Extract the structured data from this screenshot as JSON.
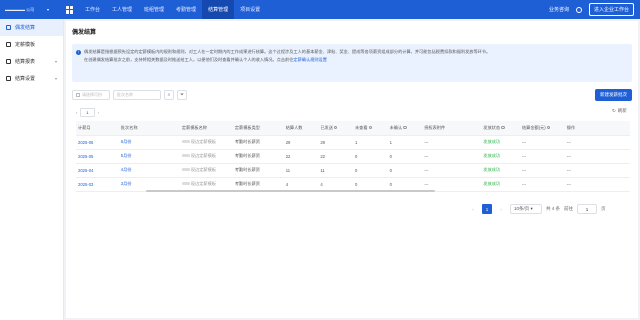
{
  "topbar": {
    "brand": "▬▬▬▬▬ 公司",
    "nav": [
      "工作台",
      "工人管理",
      "班组管理",
      "考勤管理",
      "结算管理",
      "项目设置"
    ],
    "active_nav": 4,
    "service": "业务咨询",
    "enter_button": "进入企业工作台"
  },
  "sidebar": {
    "items": [
      {
        "label": "偶发结算",
        "active": true
      },
      {
        "label": "定薪模板",
        "active": false
      },
      {
        "label": "结算报表",
        "active": false
      },
      {
        "label": "结算设置",
        "active": false
      }
    ]
  },
  "page": {
    "title": "偶发结算",
    "notice_line1": "偶发结算是指根据预先设定的定薪模板内的规则和规则，对工人在一定时期内的工作成果进行核算。这个过程涉及工人的基本薪金、津贴、奖金、提成等各项薪资组成部分的计算，并可能包括税费扣款和福利发放等环节。",
    "notice_line2_prefix": "在创建偶发结算批次之前，支持将相关数据及时推送给工人，以便他们及时查看并确认个人的收入情况。点击前往",
    "notice_link": "定薪确认规则设置"
  },
  "filters": {
    "month_placeholder": "请选择月份",
    "batch_placeholder": "批次名称",
    "search_icon": "search-icon",
    "filter_icon": "funnel-icon",
    "new_batch_button": "新建发薪批次"
  },
  "mini_pager": {
    "prev": "‹",
    "num": "1",
    "next": "›"
  },
  "refresh_label": "刷新",
  "table": {
    "headers": [
      "计薪月",
      "批次名称",
      "定薪模板名称",
      "定薪模板类型",
      "结算人数",
      "已发送",
      "未查看",
      "未确认",
      "授权表附件",
      "发放状态",
      "结算金额(元)",
      "操作"
    ],
    "rows": [
      {
        "month": "2025-06",
        "batch": "6月份",
        "template": "现边定薪模板",
        "type": "考勤时长薪资",
        "count": "29",
        "sent": "29",
        "unviewed": "1",
        "unconfirmed": "1",
        "attachment": "---",
        "status": "发放成功",
        "amount": "---",
        "op": "---"
      },
      {
        "month": "2025-05",
        "batch": "5月份",
        "template": "现边定薪模板",
        "type": "考勤时长薪资",
        "count": "22",
        "sent": "22",
        "unviewed": "0",
        "unconfirmed": "0",
        "attachment": "---",
        "status": "发放成功",
        "amount": "---",
        "op": "---"
      },
      {
        "month": "2025-04",
        "batch": "4月份",
        "template": "现边定薪模板",
        "type": "考勤时长薪资",
        "count": "11",
        "sent": "11",
        "unviewed": "0",
        "unconfirmed": "0",
        "attachment": "---",
        "status": "发放成功",
        "amount": "---",
        "op": "---"
      },
      {
        "month": "2025-03",
        "batch": "3月份",
        "template": "现边定薪模板",
        "type": "考勤时长薪资",
        "count": "4",
        "sent": "4",
        "unviewed": "0",
        "unconfirmed": "0",
        "attachment": "---",
        "status": "发放成功",
        "amount": "---",
        "op": "---"
      }
    ]
  },
  "pagination": {
    "current": "1",
    "page_size": "10条/页",
    "total": "共 4 条",
    "jump_label": "前往",
    "jump_value": "1",
    "jump_suffix": "页"
  },
  "colors": {
    "primary": "#1e5fd6",
    "success": "#2fb34a"
  }
}
